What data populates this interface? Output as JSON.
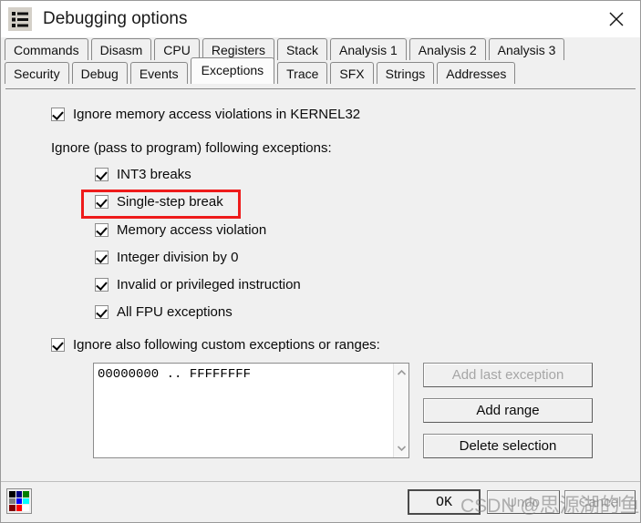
{
  "window": {
    "title": "Debugging options",
    "icon": "list-options-icon",
    "close_label": "✕"
  },
  "tabs": {
    "row1": [
      {
        "label": "Commands",
        "selected": false
      },
      {
        "label": "Disasm",
        "selected": false
      },
      {
        "label": "CPU",
        "selected": false
      },
      {
        "label": "Registers",
        "selected": false
      },
      {
        "label": "Stack",
        "selected": false
      },
      {
        "label": "Analysis 1",
        "selected": false
      },
      {
        "label": "Analysis 2",
        "selected": false
      },
      {
        "label": "Analysis 3",
        "selected": false
      }
    ],
    "row2": [
      {
        "label": "Security",
        "selected": false
      },
      {
        "label": "Debug",
        "selected": false
      },
      {
        "label": "Events",
        "selected": false
      },
      {
        "label": "Exceptions",
        "selected": true
      },
      {
        "label": "Trace",
        "selected": false
      },
      {
        "label": "SFX",
        "selected": false
      },
      {
        "label": "Strings",
        "selected": false
      },
      {
        "label": "Addresses",
        "selected": false
      }
    ]
  },
  "exceptions": {
    "kernel32_option": {
      "label": "Ignore memory access violations in KERNEL32",
      "checked": true
    },
    "group_label": "Ignore (pass to program) following exceptions:",
    "items": [
      {
        "label": "INT3 breaks",
        "checked": true,
        "highlighted": false
      },
      {
        "label": "Single-step break",
        "checked": true,
        "highlighted": true
      },
      {
        "label": "Memory access violation",
        "checked": true,
        "highlighted": false
      },
      {
        "label": "Integer division by 0",
        "checked": true,
        "highlighted": false
      },
      {
        "label": "Invalid or privileged instruction",
        "checked": true,
        "highlighted": false
      },
      {
        "label": "All FPU exceptions",
        "checked": true,
        "highlighted": false
      }
    ],
    "custom_option": {
      "label": "Ignore also following custom exceptions or ranges:",
      "checked": true
    },
    "custom_ranges": [
      "00000000 .. FFFFFFFF"
    ],
    "range_buttons": [
      {
        "label": "Add last exception",
        "disabled": true
      },
      {
        "label": "Add range",
        "disabled": false
      },
      {
        "label": "Delete selection",
        "disabled": false
      }
    ]
  },
  "footer": {
    "palette_icon": "color-palette-icon",
    "palette_colors": [
      "#000000",
      "#000080",
      "#008000",
      "#808080",
      "#0000ff",
      "#00ffff",
      "#800000",
      "#ff0000",
      "#ffffff"
    ],
    "buttons": [
      {
        "label": "OK",
        "default": true,
        "disabled": false
      },
      {
        "label": "Undo",
        "default": false,
        "disabled": true
      },
      {
        "label": "Cancel",
        "default": false,
        "disabled": true
      }
    ]
  },
  "watermark": {
    "prefix": "CSDN @",
    "text": "思源湖的鱼"
  },
  "colors": {
    "highlight": "#ee1b1b",
    "window_bg": "#f0f0f0",
    "field_bg": "#ffffff"
  }
}
